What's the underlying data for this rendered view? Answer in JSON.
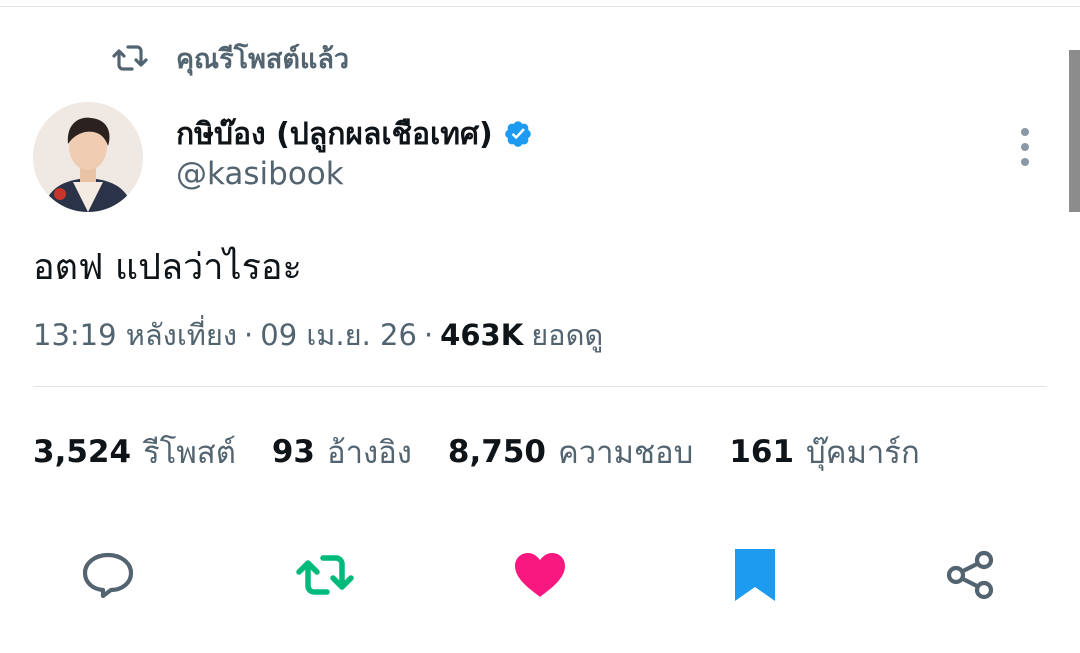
{
  "retweet_context": {
    "icon": "retweet-icon",
    "label": "คุณรีโพสต์แล้ว"
  },
  "author": {
    "display_name": "กษิบ๊อง (ปลูกผลเชือเทศ)",
    "handle": "@kasibook",
    "verified": true,
    "verified_color": "#1d9bf0"
  },
  "tweet": {
    "text": "อตฟ แปลว่าไรอะ",
    "time": "13:19 หลังเที่ยง",
    "separator": "·",
    "date": "09 เม.ย. 26",
    "views_count": "463K",
    "views_label": "ยอดดู"
  },
  "stats": [
    {
      "count": "3,524",
      "label": "รีโพสต์"
    },
    {
      "count": "93",
      "label": "อ้างอิง"
    },
    {
      "count": "8,750",
      "label": "ความชอบ"
    },
    {
      "count": "161",
      "label": "บุ๊คมาร์ก"
    }
  ],
  "actions": [
    {
      "icon": "reply-icon",
      "active": false,
      "color": "#536471"
    },
    {
      "icon": "retweet-icon",
      "active": true,
      "color": "#00ba7c"
    },
    {
      "icon": "heart-icon",
      "active": true,
      "color": "#f91880"
    },
    {
      "icon": "bookmark-icon",
      "active": true,
      "color": "#1d9bf0"
    },
    {
      "icon": "share-icon",
      "active": false,
      "color": "#536471"
    }
  ]
}
